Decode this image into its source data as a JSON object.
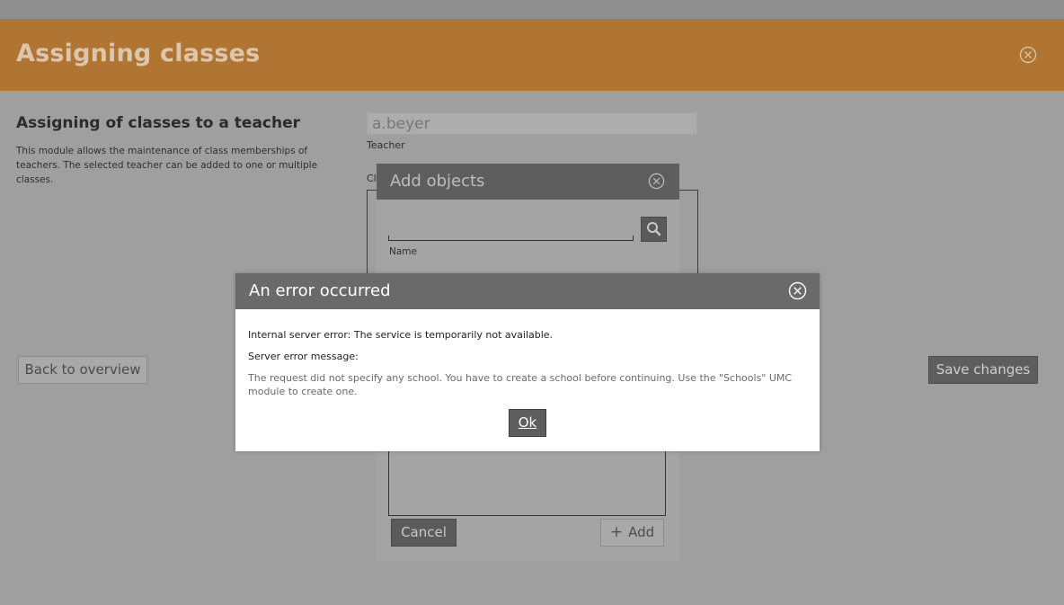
{
  "module": {
    "title": "Assigning classes",
    "close_icon": "close-circle-icon"
  },
  "main": {
    "section_title": "Assigning of classes to a teacher",
    "description": "This module allows the maintenance of class memberships of teachers. The selected teacher can be added to one or multiple classes.",
    "teacher_value": "a.beyer",
    "teacher_label": "Teacher",
    "classes_label": "Classes",
    "back_button": "Back to overview",
    "save_button": "Save changes"
  },
  "add_dialog": {
    "title": "Add objects",
    "search_value": "",
    "search_icon": "search-icon",
    "name_label": "Name",
    "cancel_button": "Cancel",
    "add_button": "Add",
    "add_icon": "plus-icon"
  },
  "error_dialog": {
    "title": "An error occurred",
    "line1": "Internal server error: The service is temporarily not available.",
    "line2": "Server error message:",
    "message": "The request did not specify any school. You have to create a school before continuing. Use the \"Schools\" UMC module to create one.",
    "ok_button": "Ok"
  },
  "colors": {
    "header": "#b07533",
    "overlay": "#9f9f9f",
    "dialog_header": "#6a6a6a",
    "button_dark": "#5e5e5e"
  }
}
